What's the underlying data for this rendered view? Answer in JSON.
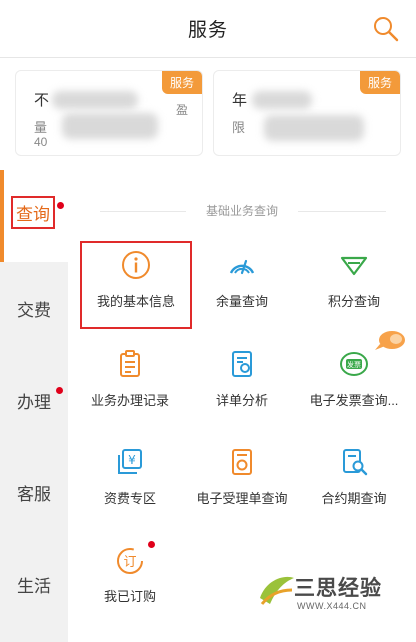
{
  "header": {
    "title": "服务",
    "search_icon": "search-icon"
  },
  "cards": [
    {
      "title": "不",
      "badge": "服务",
      "tail": "量",
      "suffix": "盈",
      "num": "40"
    },
    {
      "title": "年",
      "badge": "服务",
      "tail": "限",
      "suffix": ""
    }
  ],
  "sidebar": {
    "items": [
      {
        "label": "查询"
      },
      {
        "label": "交费"
      },
      {
        "label": "办理"
      },
      {
        "label": "客服"
      },
      {
        "label": "生活"
      }
    ]
  },
  "section": {
    "title": "基础业务查询"
  },
  "grid": [
    {
      "label": "我的基本信息",
      "icon": "info-icon"
    },
    {
      "label": "余量查询",
      "icon": "gauge-icon"
    },
    {
      "label": "积分查询",
      "icon": "gem-icon"
    },
    {
      "label": "业务办理记录",
      "icon": "clipboard-icon"
    },
    {
      "label": "详单分析",
      "icon": "chart-doc-icon"
    },
    {
      "label": "电子发票查询...",
      "icon": "invoice-icon"
    },
    {
      "label": "资费专区",
      "icon": "yuan-icon"
    },
    {
      "label": "电子受理单查询",
      "icon": "receipt-icon"
    },
    {
      "label": "合约期查询",
      "icon": "doc-search-icon"
    },
    {
      "label": "我已订购",
      "icon": "subscribed-icon"
    }
  ],
  "icon_text": {
    "invoice": "发票",
    "subscribed": "订",
    "yuan": "¥"
  },
  "watermark": {
    "text": "三思经验",
    "sub": "WWW.X444.CN"
  },
  "colors": {
    "accent": "#f08a2c",
    "highlight": "#e02a2a",
    "dot": "#e0001a",
    "teal": "#2a9ad8",
    "green": "#3aa84a"
  }
}
